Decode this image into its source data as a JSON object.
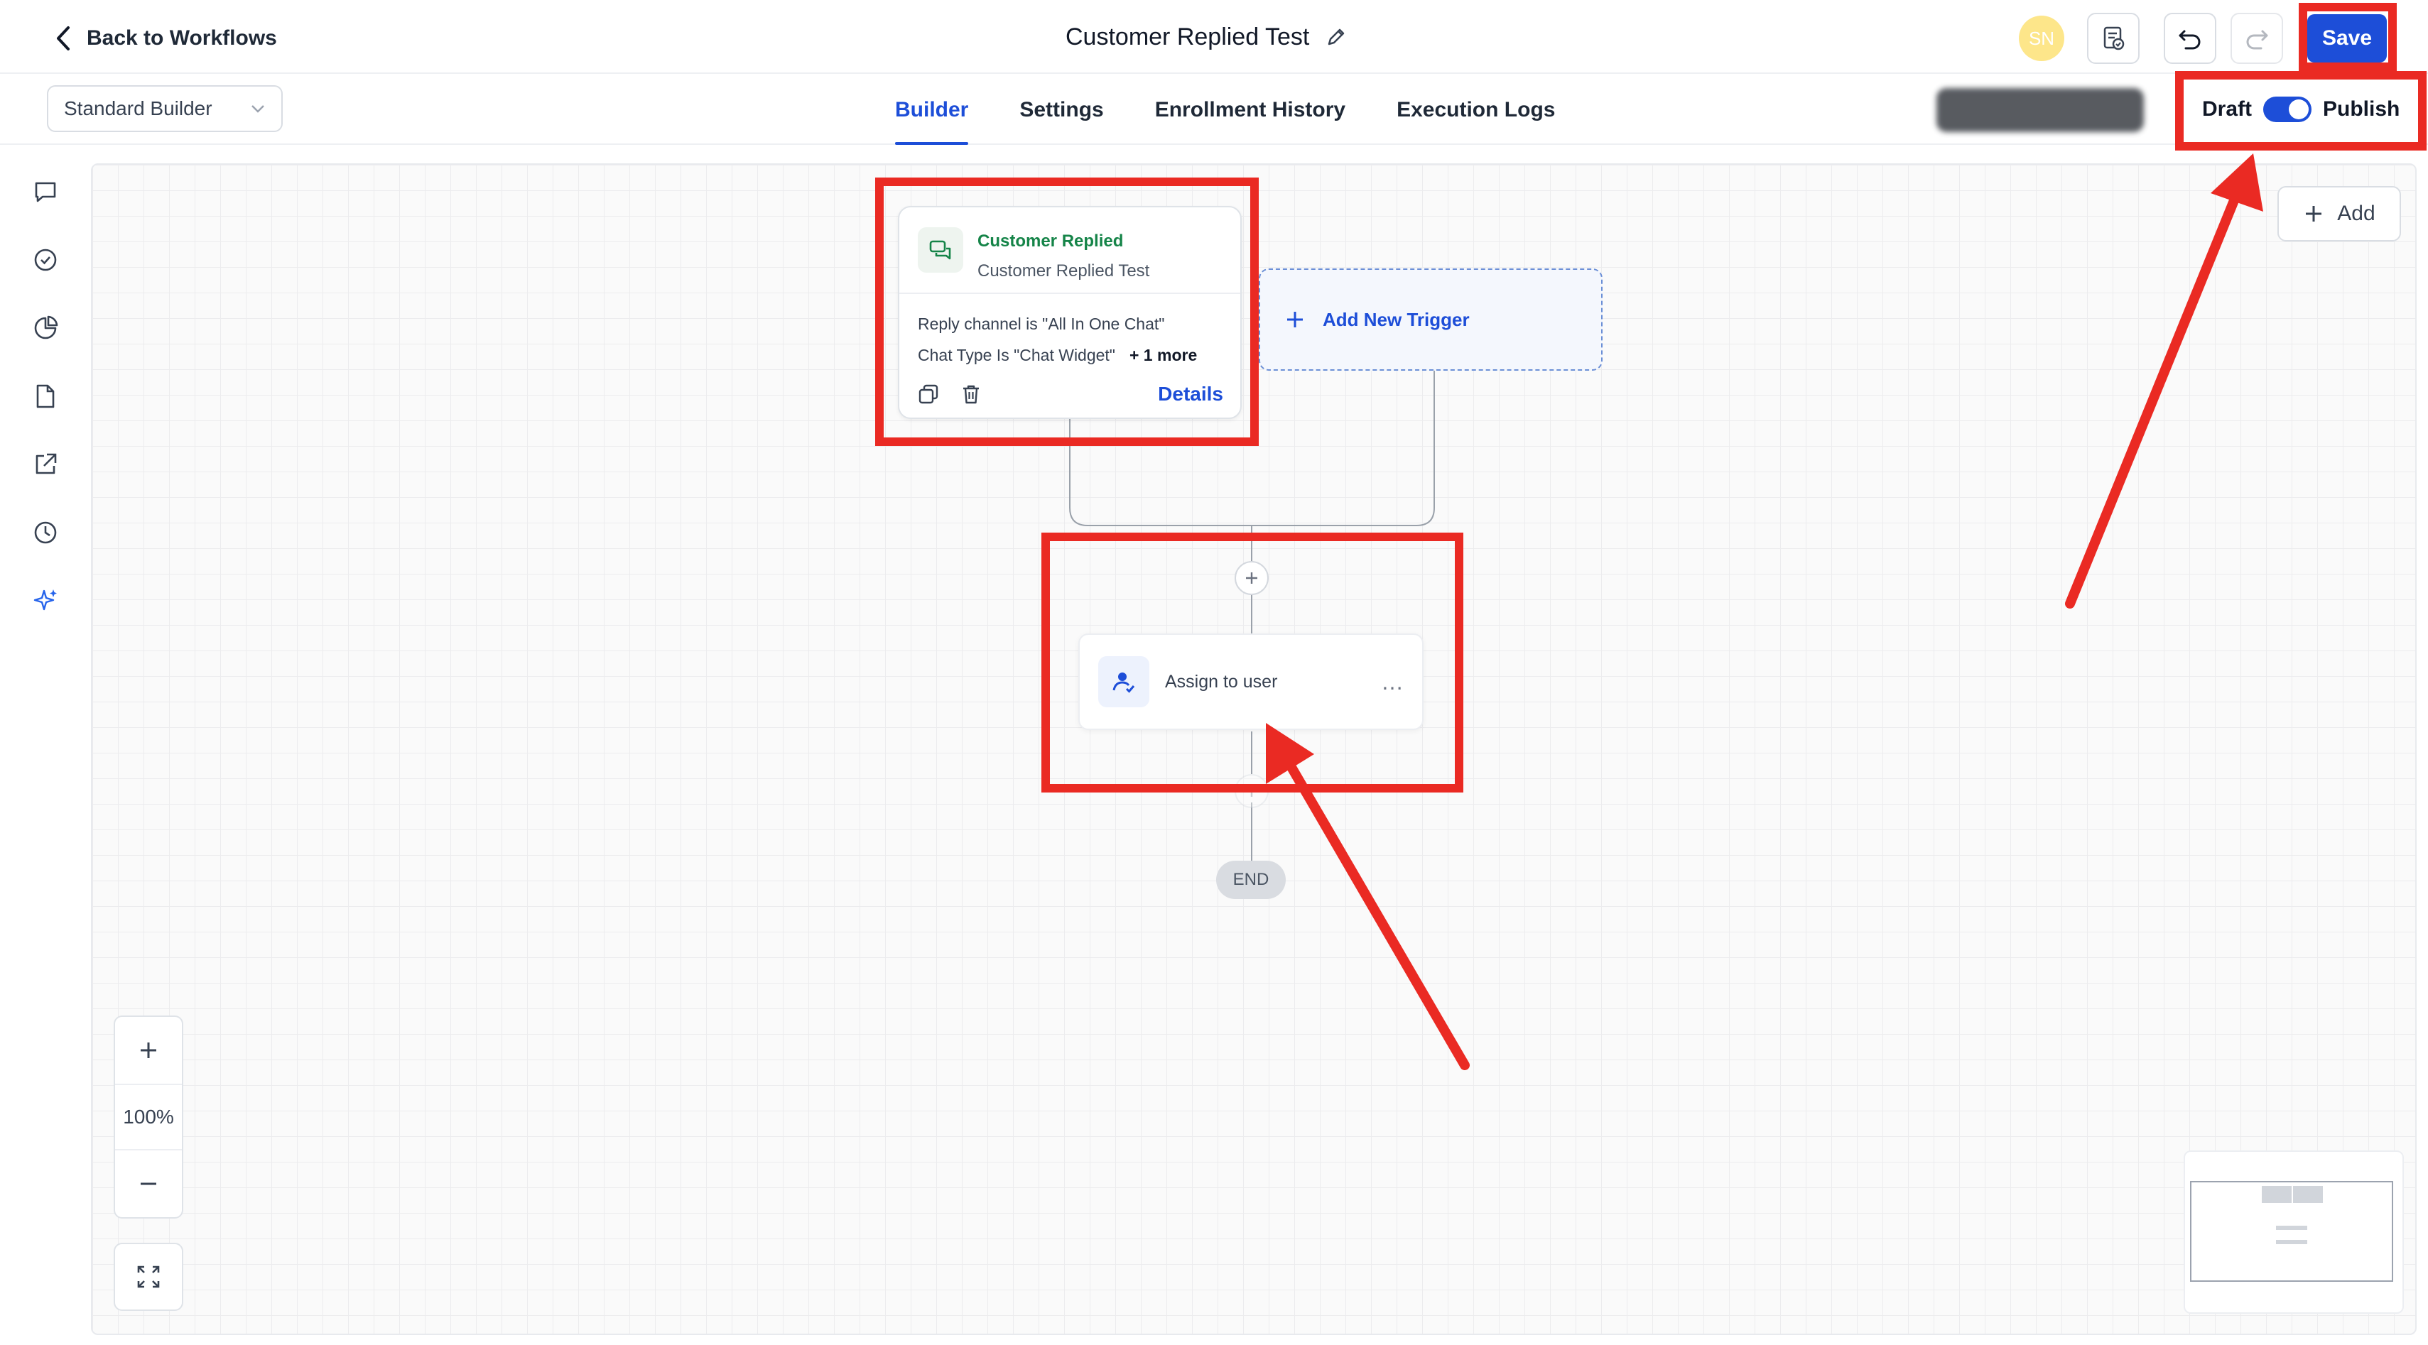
{
  "header": {
    "back_label": "Back to Workflows",
    "workflow_title": "Customer Replied Test",
    "avatar_initials": "SN",
    "save_label": "Save"
  },
  "subheader": {
    "builder_select_value": "Standard Builder",
    "tabs": [
      {
        "label": "Builder",
        "active": true
      },
      {
        "label": "Settings",
        "active": false
      },
      {
        "label": "Enrollment History",
        "active": false
      },
      {
        "label": "Execution Logs",
        "active": false
      }
    ],
    "draft_label": "Draft",
    "publish_label": "Publish",
    "publish_toggle_on": true
  },
  "rail": {
    "icons": [
      "chat-icon",
      "check-circle-icon",
      "pie-chart-icon",
      "file-icon",
      "external-link-icon",
      "history-icon",
      "sparkle-icon"
    ]
  },
  "canvas": {
    "add_label": "Add",
    "trigger": {
      "type": "Customer Replied",
      "name": "Customer Replied Test",
      "conditions": [
        "Reply channel is \"All In One Chat\"",
        "Chat Type Is \"Chat Widget\""
      ],
      "more_label": "+ 1 more",
      "details_label": "Details"
    },
    "add_trigger_label": "Add New Trigger",
    "action": {
      "label": "Assign to user",
      "menu_glyph": "…"
    },
    "end_label": "END",
    "zoom_level": "100%"
  },
  "colors": {
    "primary": "#1d4ed8",
    "trigger_green": "#158448",
    "annotation_red": "#ea2a23"
  }
}
